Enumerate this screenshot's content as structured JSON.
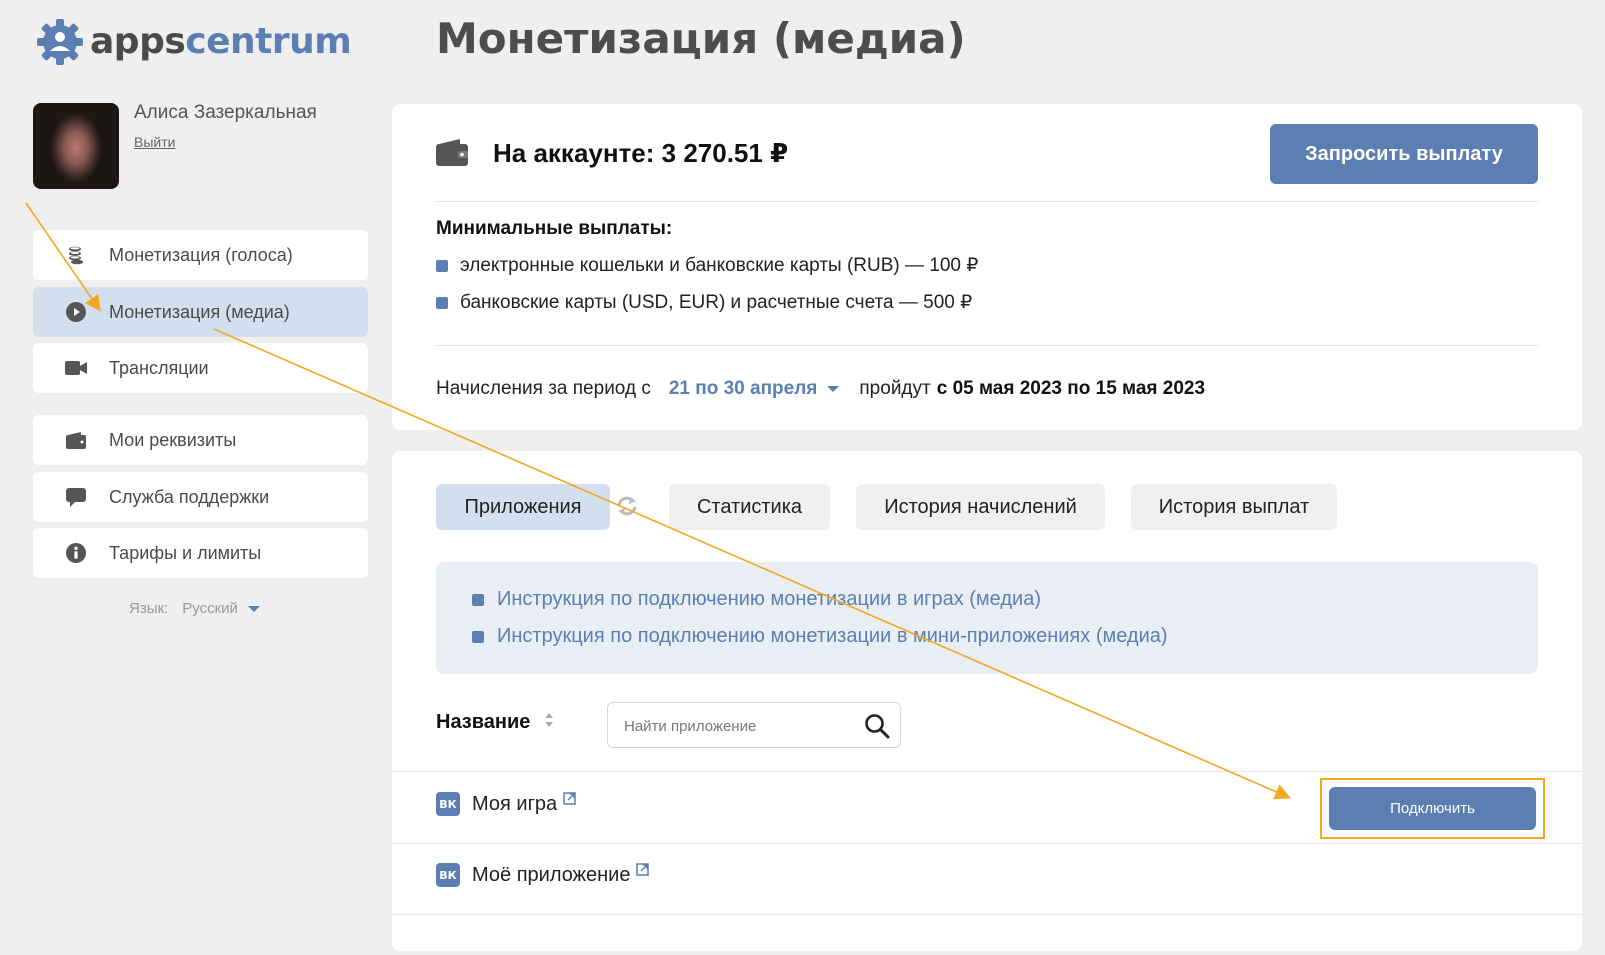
{
  "logo": {
    "part1": "apps",
    "part2": "centrum"
  },
  "page_title": "Монетизация (медиа)",
  "user": {
    "name": "Алиса Зазеркальная",
    "logout": "Выйти"
  },
  "sidebar": {
    "items": [
      {
        "label": "Монетизация (голоса)",
        "icon": "coins-icon"
      },
      {
        "label": "Монетизация (медиа)",
        "icon": "play-circle-icon",
        "active": true
      },
      {
        "label": "Трансляции",
        "icon": "video-camera-icon"
      },
      {
        "label": "Мои реквизиты",
        "icon": "wallet-icon"
      },
      {
        "label": "Служба поддержки",
        "icon": "chat-bubble-icon"
      },
      {
        "label": "Тарифы и лимиты",
        "icon": "info-icon"
      }
    ],
    "language_label": "Язык:",
    "language_value": "Русский"
  },
  "account": {
    "balance_text": "На аккаунте: 3 270.51 ₽",
    "payout_button": "Запросить выплату",
    "min_title": "Минимальные выплаты:",
    "min_items": [
      "электронные кошельки и банковские карты (RUB) — 100 ₽",
      "банковские карты (USD, EUR) и расчетные счета — 500 ₽"
    ],
    "period_prefix": "Начисления за период с",
    "period_range": "21 по 30 апреля",
    "period_middle": "пройдут",
    "period_dates": "с 05 мая 2023 по 15 мая 2023"
  },
  "tabs": [
    {
      "label": "Приложения",
      "active": true
    },
    {
      "label": "Статистика"
    },
    {
      "label": "История начислений"
    },
    {
      "label": "История выплат"
    }
  ],
  "instructions": [
    "Инструкция по подключению монетизации в играх (медиа)",
    "Инструкция по подключению монетизации в мини-приложениях (медиа)"
  ],
  "table": {
    "column_name": "Название",
    "search_placeholder": "Найти приложение",
    "rows": [
      {
        "name": "Моя игра",
        "badge": "ВК",
        "action": "Подключить"
      },
      {
        "name": "Моё приложение",
        "badge": "ВК"
      }
    ]
  },
  "colors": {
    "accent": "#5b7fb2",
    "active_bg": "#d3dfee",
    "annotation": "#f2a81f"
  }
}
